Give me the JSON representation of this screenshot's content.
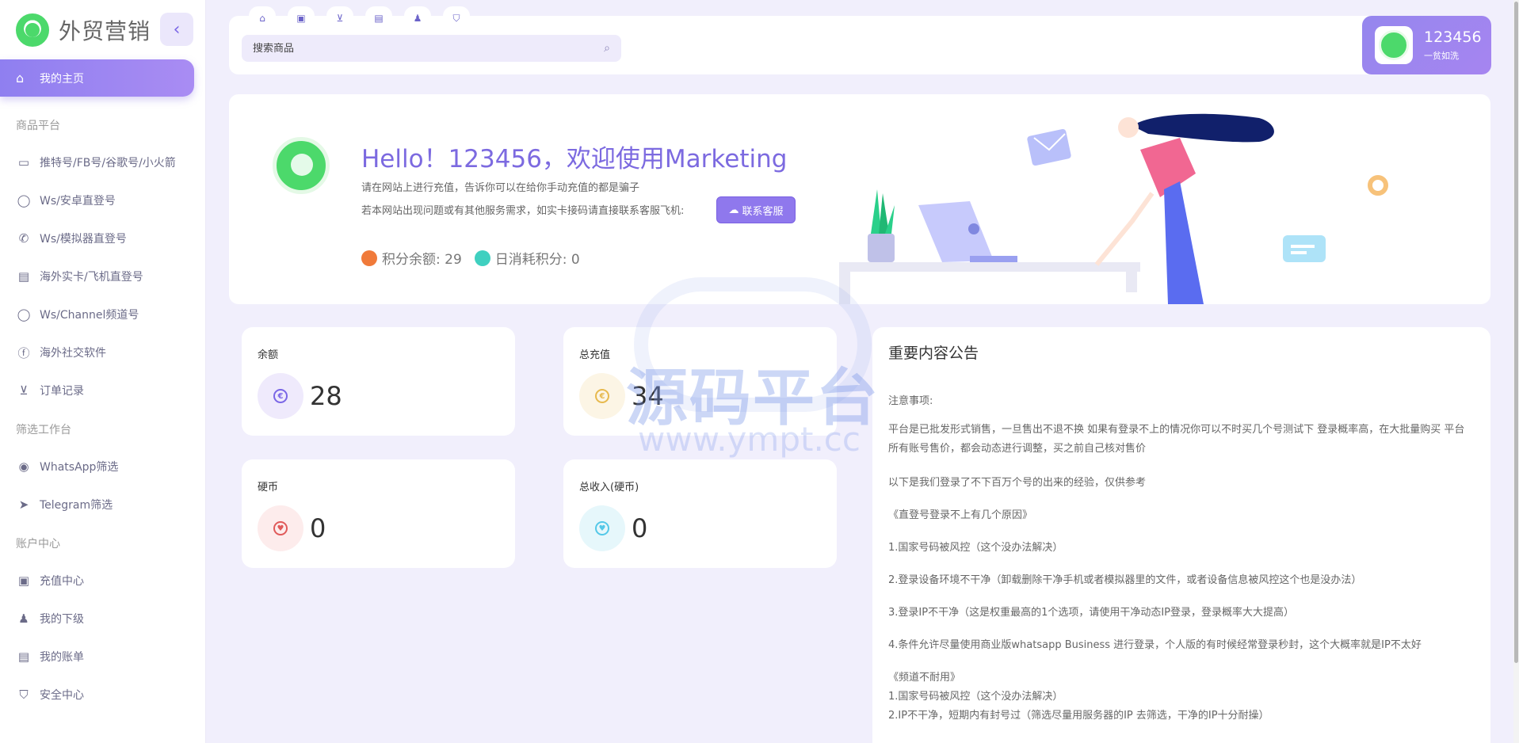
{
  "sidebar": {
    "brand": "外贸营销",
    "active_item": {
      "label": "我的主页",
      "icon": "home-icon"
    },
    "sections": [
      {
        "title": "商品平台"
      },
      {
        "title": "筛选工作台"
      },
      {
        "title": "账户中心"
      }
    ],
    "items": [
      {
        "label": "推特号/FB号/谷歌号/小火箭",
        "icon": "message-icon"
      },
      {
        "label": "Ws/安卓直登号",
        "icon": "whatsapp-icon"
      },
      {
        "label": "Ws/模拟器直登号",
        "icon": "phone-icon"
      },
      {
        "label": "海外实卡/飞机直登号",
        "icon": "document-icon"
      },
      {
        "label": "Ws/Channel频道号",
        "icon": "whatsapp-icon"
      },
      {
        "label": "海外社交软件",
        "icon": "facebook-icon"
      },
      {
        "label": "订单记录",
        "icon": "cart-icon"
      },
      {
        "label": "WhatsApp筛选",
        "icon": "whatsapp-icon"
      },
      {
        "label": "Telegram筛选",
        "icon": "telegram-icon"
      },
      {
        "label": "充值中心",
        "icon": "wallet-icon"
      },
      {
        "label": "我的下级",
        "icon": "user-star-icon"
      },
      {
        "label": "我的账单",
        "icon": "bill-icon"
      },
      {
        "label": "安全中心",
        "icon": "shield-icon"
      }
    ]
  },
  "topbar": {
    "tabs": [
      {
        "icon": "home-icon"
      },
      {
        "icon": "wallet-icon"
      },
      {
        "icon": "cart-icon"
      },
      {
        "icon": "bill-icon"
      },
      {
        "icon": "user-star-icon"
      },
      {
        "icon": "shield-icon"
      }
    ],
    "search_placeholder": "搜索商品"
  },
  "user": {
    "name": "123456",
    "subtitle": "一贫如洗"
  },
  "welcome": {
    "title": "Hello！123456，欢迎使用Marketing",
    "line1": "请在网站上进行充值，告诉你可以在给你手动充值的都是骗子",
    "line2": "若本网站出现问题或有其他服务需求，如实卡接码请直接联系客服飞机:",
    "contact_button": "联系客服",
    "points_label": "积分余额: 29",
    "daily_label": "日消耗积分: 0"
  },
  "cards": [
    {
      "label": "余额",
      "value": "28",
      "color": "#7a66e6",
      "bg": "#efeafc"
    },
    {
      "label": "总充值",
      "value": "34",
      "color": "#e7b94d",
      "bg": "#fcf5e5"
    },
    {
      "label": "硬币",
      "value": "0",
      "color": "#e05a5a",
      "bg": "#fdecec"
    },
    {
      "label": "总收入(硬币)",
      "value": "0",
      "color": "#54c8e8",
      "bg": "#e6f7fb"
    }
  ],
  "announcement": {
    "title": "重要内容公告",
    "lines": [
      "注意事项:",
      "平台是已批发形式销售，一旦售出不退不换 如果有登录不上的情况你可以不时买几个号测试下 登录概率高，在大批量购买 平台所有账号售价，都会动态进行调整，买之前自己核对售价",
      "以下是我们登录了不下百万个号的出来的经验，仅供参考",
      "《直登号登录不上有几个原因》",
      "1.国家号码被风控（这个没办法解决）",
      "2.登录设备环境不干净（卸载删除干净手机或者模拟器里的文件，或者设备信息被风控这个也是没办法）",
      "3.登录IP不干净（这是权重最高的1个选项，请使用干净动态IP登录，登录概率大大提高）",
      "4.条件允许尽量使用商业版whatsapp Business 进行登录，个人版的有时候经常登录秒封，这个大概率就是IP不太好",
      "《频道不耐用》",
      "1.国家号码被风控（这个没办法解决）",
      "2.IP不干净，短期内有封号过（筛选尽量用服务器的IP 去筛选，干净的IP十分耐操）"
    ]
  },
  "watermark": {
    "text": "源码平台",
    "url": "www.ympt.cc"
  }
}
